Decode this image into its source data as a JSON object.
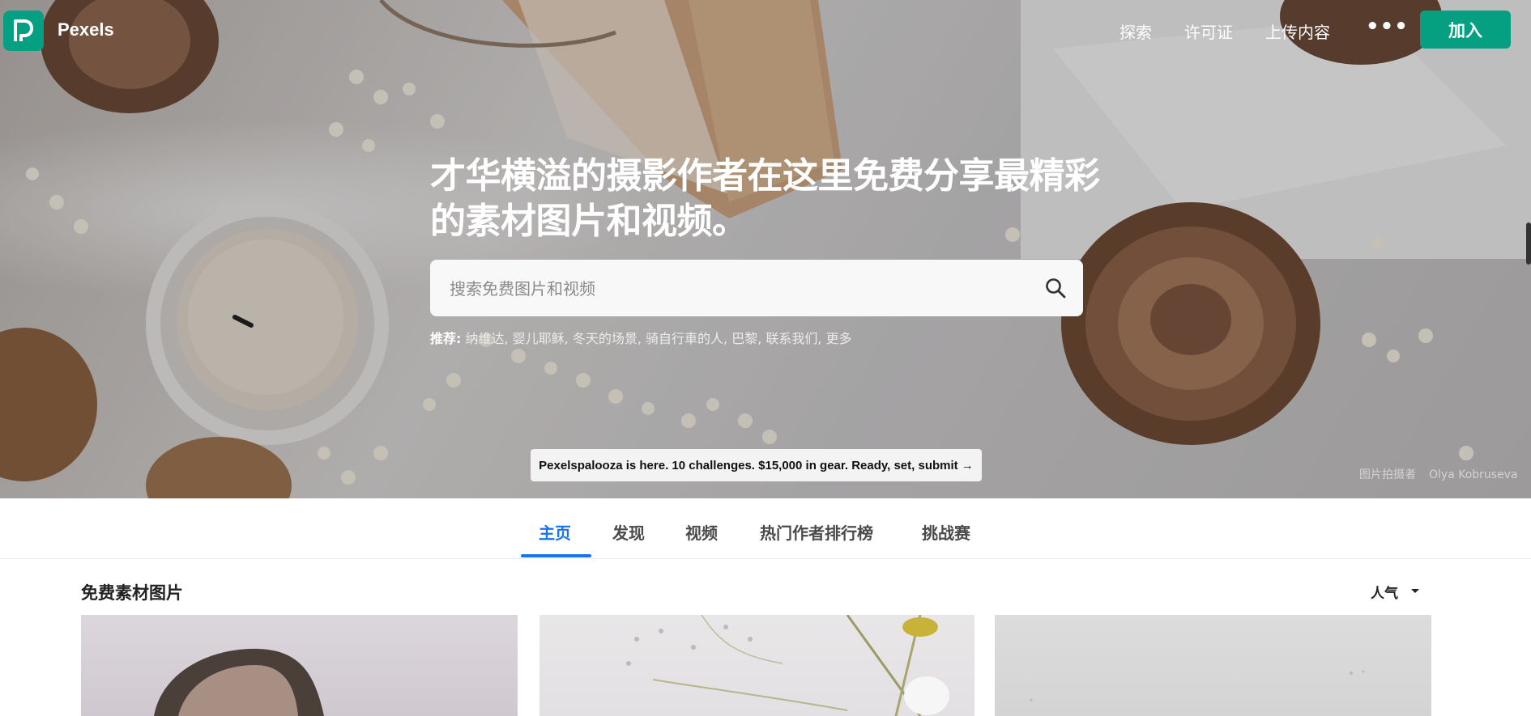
{
  "nav": {
    "logo_text": "Pexels",
    "links": [
      "探索",
      "许可证",
      "上传内容"
    ],
    "more_label": "•••",
    "join_label": "加入"
  },
  "hero": {
    "headline": "才华横溢的摄影作者在这里免费分享最精彩的素材图片和视频。",
    "search_placeholder": "搜索免费图片和视频",
    "suggest_label": "推荐:",
    "suggestions": "纳维达, 婴儿耶稣, 冬天的场景, 骑自行車的人, 巴黎, 联系我们, 更多",
    "banner": "Pexelspalooza is here. 10 challenges. $15,000 in gear. Ready, set, submit →",
    "credit_label": "图片拍摄者",
    "credit_author": "Olya Kobruseva"
  },
  "tabs": [
    "主页",
    "发现",
    "视频",
    "热门作者排行榜",
    "挑战赛"
  ],
  "section": {
    "title": "免费素材图片",
    "sort_label": "人气"
  },
  "colors": {
    "brand": "#05a081",
    "active_tab": "#1a73e8"
  }
}
